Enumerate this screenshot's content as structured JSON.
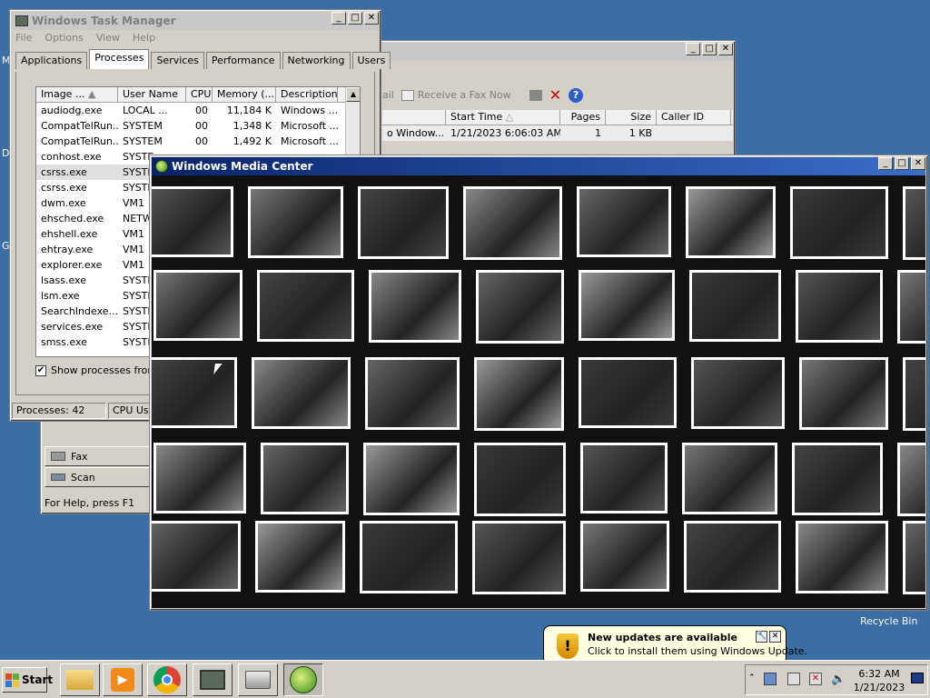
{
  "desktop": {
    "recycle_bin": "Recycle Bin",
    "frag_m": "M",
    "frag_d": "D",
    "frag_g": "G"
  },
  "task_manager": {
    "title": "Windows Task Manager",
    "menu": [
      "File",
      "Options",
      "View",
      "Help"
    ],
    "tabs": [
      "Applications",
      "Processes",
      "Services",
      "Performance",
      "Networking",
      "Users"
    ],
    "columns": [
      "Image ...",
      "User Name",
      "CPU",
      "Memory (...",
      "Description"
    ],
    "rows": [
      [
        "audiodg.exe",
        "LOCAL ...",
        "00",
        "11,184 K",
        "Windows ..."
      ],
      [
        "CompatTelRun...",
        "SYSTEM",
        "00",
        "1,348 K",
        "Microsoft ..."
      ],
      [
        "CompatTelRun...",
        "SYSTEM",
        "00",
        "1,492 K",
        "Microsoft ..."
      ],
      [
        "conhost.exe",
        "SYSTE",
        "",
        "",
        ""
      ],
      [
        "csrss.exe",
        "SYSTE",
        "",
        "",
        ""
      ],
      [
        "csrss.exe",
        "SYSTE",
        "",
        "",
        ""
      ],
      [
        "dwm.exe",
        "VM1",
        "",
        "",
        ""
      ],
      [
        "ehsched.exe",
        "NETW",
        "",
        "",
        ""
      ],
      [
        "ehshell.exe",
        "VM1",
        "",
        "",
        ""
      ],
      [
        "ehtray.exe",
        "VM1",
        "",
        "",
        ""
      ],
      [
        "explorer.exe",
        "VM1",
        "",
        "",
        ""
      ],
      [
        "lsass.exe",
        "SYSTE",
        "",
        "",
        ""
      ],
      [
        "lsm.exe",
        "SYSTE",
        "",
        "",
        ""
      ],
      [
        "SearchIndexe...",
        "SYSTE",
        "",
        "",
        ""
      ],
      [
        "services.exe",
        "SYSTE",
        "",
        "",
        ""
      ],
      [
        "smss.exe",
        "SYSTE",
        "",
        "",
        ""
      ]
    ],
    "show_all_label": "Show processes from a",
    "processes_status": "Processes: 42",
    "cpu_status": "CPU Usa"
  },
  "fax": {
    "toolbar_partial": "ail",
    "receive_label": "Receive a Fax Now",
    "columns": [
      "Start Time",
      "Pages",
      "Size",
      "Caller ID"
    ],
    "row": {
      "from": "o Window...",
      "start_time": "1/21/2023 6:06:03 AM",
      "pages": "1",
      "size": "1 KB"
    },
    "sidebar": [
      "Fax",
      "Scan"
    ],
    "status": "For Help, press F1"
  },
  "media_center": {
    "title": "Windows Media Center"
  },
  "balloon": {
    "title": "New updates are available",
    "text": "Click to install them using Windows Update."
  },
  "taskbar": {
    "start_label": "Start",
    "time": "6:32 AM",
    "date": "1/21/2023"
  }
}
